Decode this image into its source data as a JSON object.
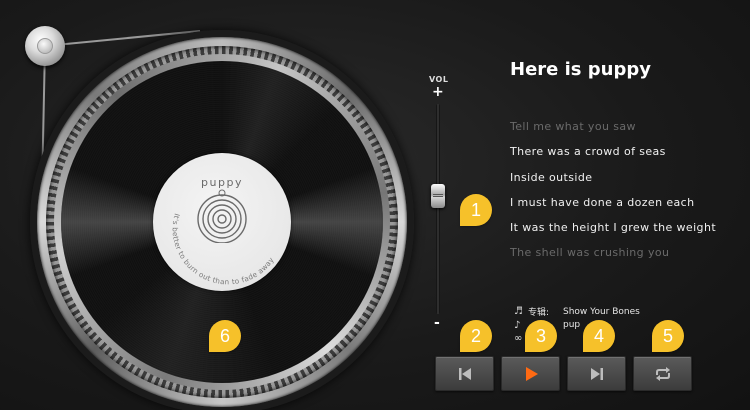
{
  "song": {
    "title": "Here is puppy"
  },
  "lyrics": [
    {
      "text": "Tell me what you saw",
      "faded": true
    },
    {
      "text": "There was a crowd of seas",
      "faded": false
    },
    {
      "text": "Inside outside",
      "faded": false
    },
    {
      "text": "I must have done a dozen each",
      "faded": false
    },
    {
      "text": "It was the height I grew the weight",
      "faded": false
    },
    {
      "text": "The shell was crushing you",
      "faded": true
    }
  ],
  "record": {
    "brand": "puppy",
    "motto": "It's better to burn out than to fade away"
  },
  "volume": {
    "label": "VOL",
    "plus": "+",
    "minus": "-",
    "level": 0.57
  },
  "meta": {
    "album_label": "专辑:",
    "album_value": "Show Your Bones",
    "artist_label": "",
    "artist_value": "pup",
    "source_label": "网络",
    "source_value": ""
  },
  "controls": [
    "prev",
    "play",
    "next",
    "repeat"
  ],
  "badges": [
    "1",
    "2",
    "3",
    "4",
    "5",
    "6"
  ],
  "colors": {
    "accent": "#f6c12a",
    "play": "#ff6a13",
    "background": "#1a1a1a"
  }
}
